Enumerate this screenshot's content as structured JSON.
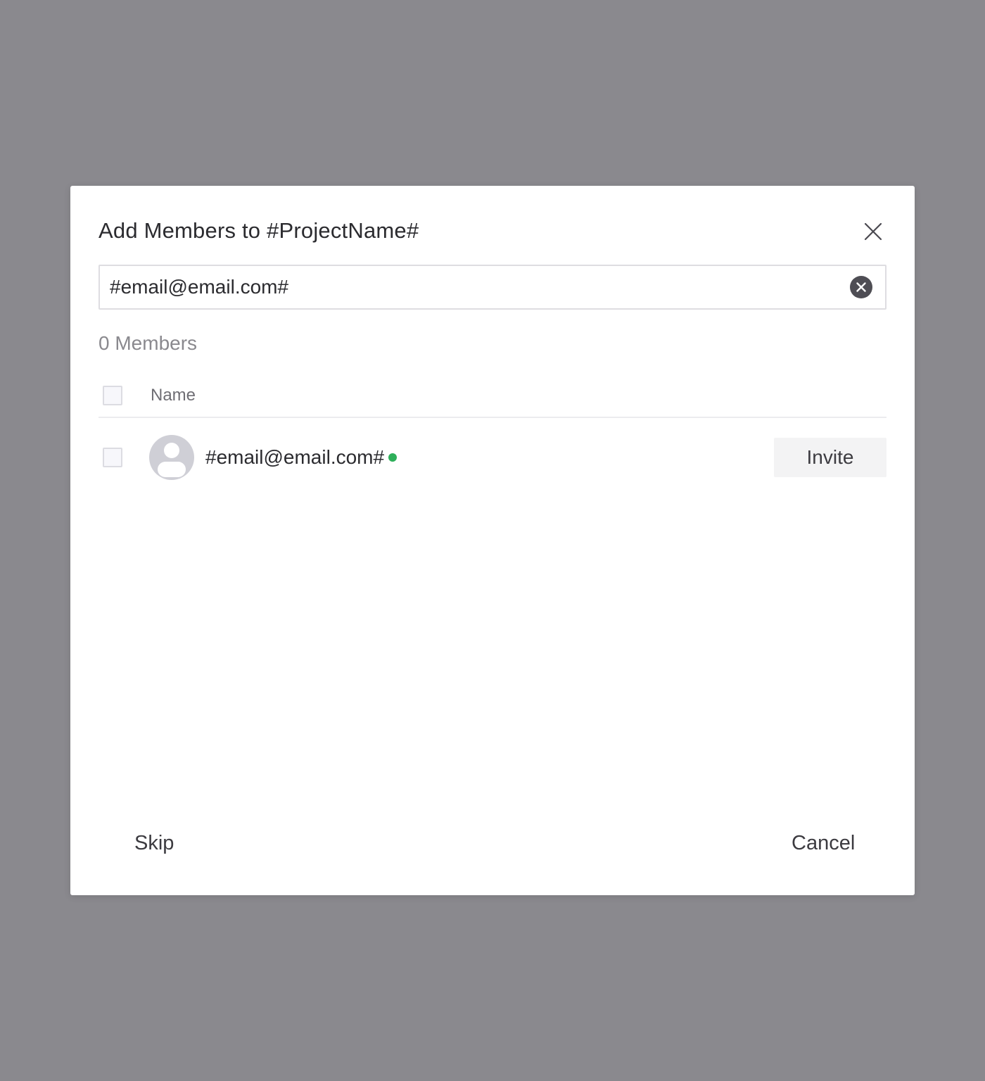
{
  "dialog": {
    "title": "Add Members to #ProjectName#"
  },
  "search": {
    "value": "#email@email.com#",
    "placeholder": ""
  },
  "member_count": "0 Members",
  "table": {
    "header_name": "Name",
    "rows": [
      {
        "email": "#email@email.com#",
        "status": "online",
        "action_label": "Invite"
      }
    ]
  },
  "footer": {
    "skip_label": "Skip",
    "cancel_label": "Cancel"
  },
  "colors": {
    "overlay": "#8a898e",
    "status_online": "#2eaf5a",
    "avatar_bg": "#cfcfd6"
  },
  "icons": {
    "close": "close-icon",
    "clear": "clear-icon",
    "avatar": "user-avatar-icon"
  }
}
